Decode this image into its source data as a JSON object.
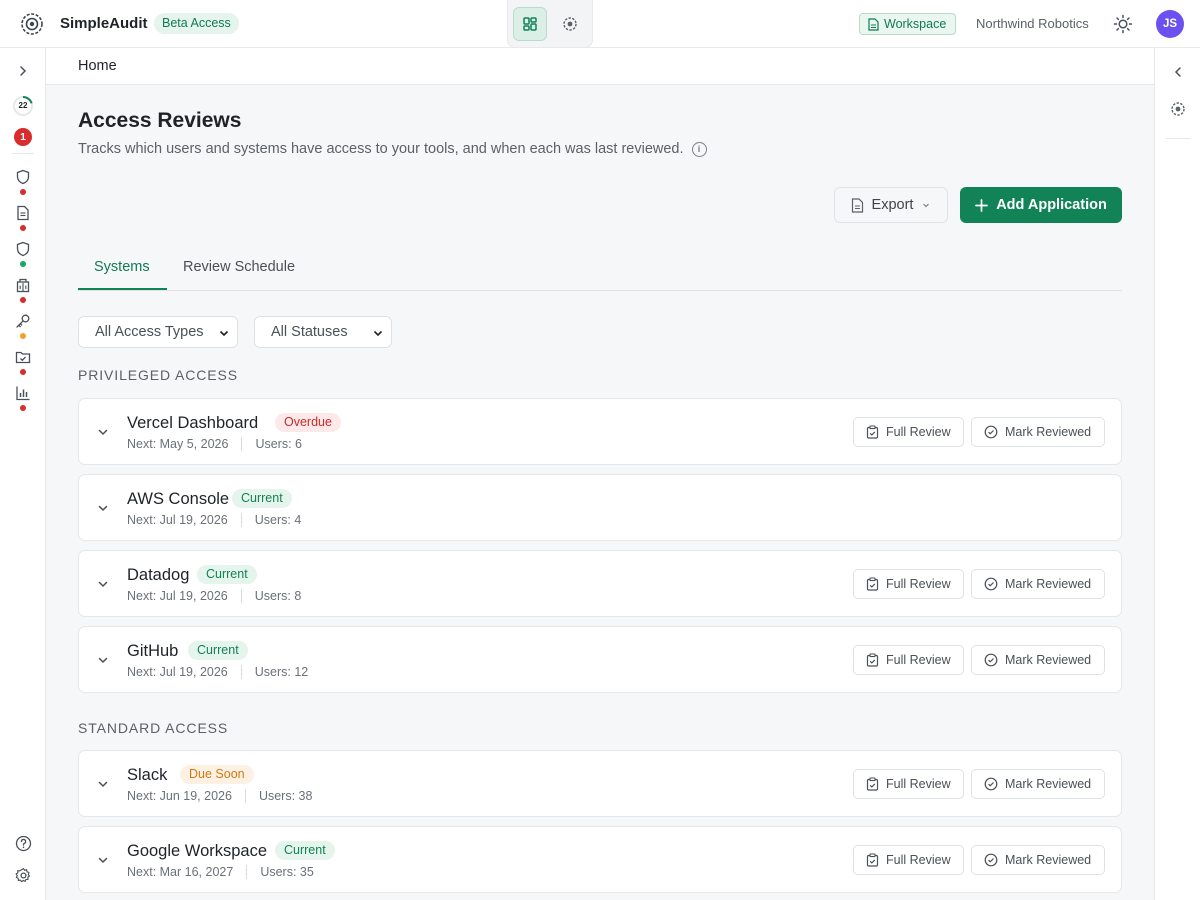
{
  "app": {
    "name": "SimpleAudit",
    "badge": "Beta Access"
  },
  "header": {
    "workspace_label": "Workspace",
    "org_name": "Northwind Robotics",
    "user_initials": "JS"
  },
  "sidebar": {
    "progress_count": "22",
    "notification_count": "1",
    "items": [
      {
        "icon": "shield-icon",
        "dot": "#d92c2c"
      },
      {
        "icon": "document-icon",
        "dot": "#d92c2c"
      },
      {
        "icon": "shield-icon",
        "dot": "#1aa56b"
      },
      {
        "icon": "building-icon",
        "dot": "#d92c2c"
      },
      {
        "icon": "key-icon",
        "dot": "#f0a12a"
      },
      {
        "icon": "folder-check-icon",
        "dot": "#d92c2c"
      },
      {
        "icon": "chart-icon",
        "dot": "#d92c2c"
      }
    ]
  },
  "breadcrumb": "Home",
  "page": {
    "title": "Access Reviews",
    "subtitle": "Tracks which users and systems have access to your tools, and when each was last reviewed.",
    "export_label": "Export",
    "add_label": "Add Application"
  },
  "tabs": [
    {
      "label": "Systems"
    },
    {
      "label": "Review Schedule"
    }
  ],
  "filters": {
    "access_type": "All Access Types",
    "status": "All Statuses"
  },
  "sections": [
    {
      "label": "PRIVILEGED ACCESS",
      "apps": [
        {
          "name": "Vercel Dashboard",
          "status": "Overdue",
          "next": "Next: May 5, 2026",
          "users": "Users: 6",
          "actions": true
        },
        {
          "name": "AWS Console",
          "status": "Current",
          "next": "Next: Jul 19, 2026",
          "users": "Users: 4",
          "actions": false
        },
        {
          "name": "Datadog",
          "status": "Current",
          "next": "Next: Jul 19, 2026",
          "users": "Users: 8",
          "actions": true
        },
        {
          "name": "GitHub",
          "status": "Current",
          "next": "Next: Jul 19, 2026",
          "users": "Users: 12",
          "actions": true
        }
      ]
    },
    {
      "label": "STANDARD ACCESS",
      "apps": [
        {
          "name": "Slack",
          "status": "Due Soon",
          "next": "Next: Jun 19, 2026",
          "users": "Users: 38",
          "actions": true
        },
        {
          "name": "Google Workspace",
          "status": "Current",
          "next": "Next: Mar 16, 2027",
          "users": "Users: 35",
          "actions": true
        }
      ]
    }
  ],
  "actions": {
    "full_review": "Full Review",
    "mark_reviewed": "Mark Reviewed"
  },
  "colors": {
    "accent": "#128257",
    "overdue": "#c92a2a",
    "due_soon": "#d27814",
    "avatar": "#6b52f0"
  }
}
